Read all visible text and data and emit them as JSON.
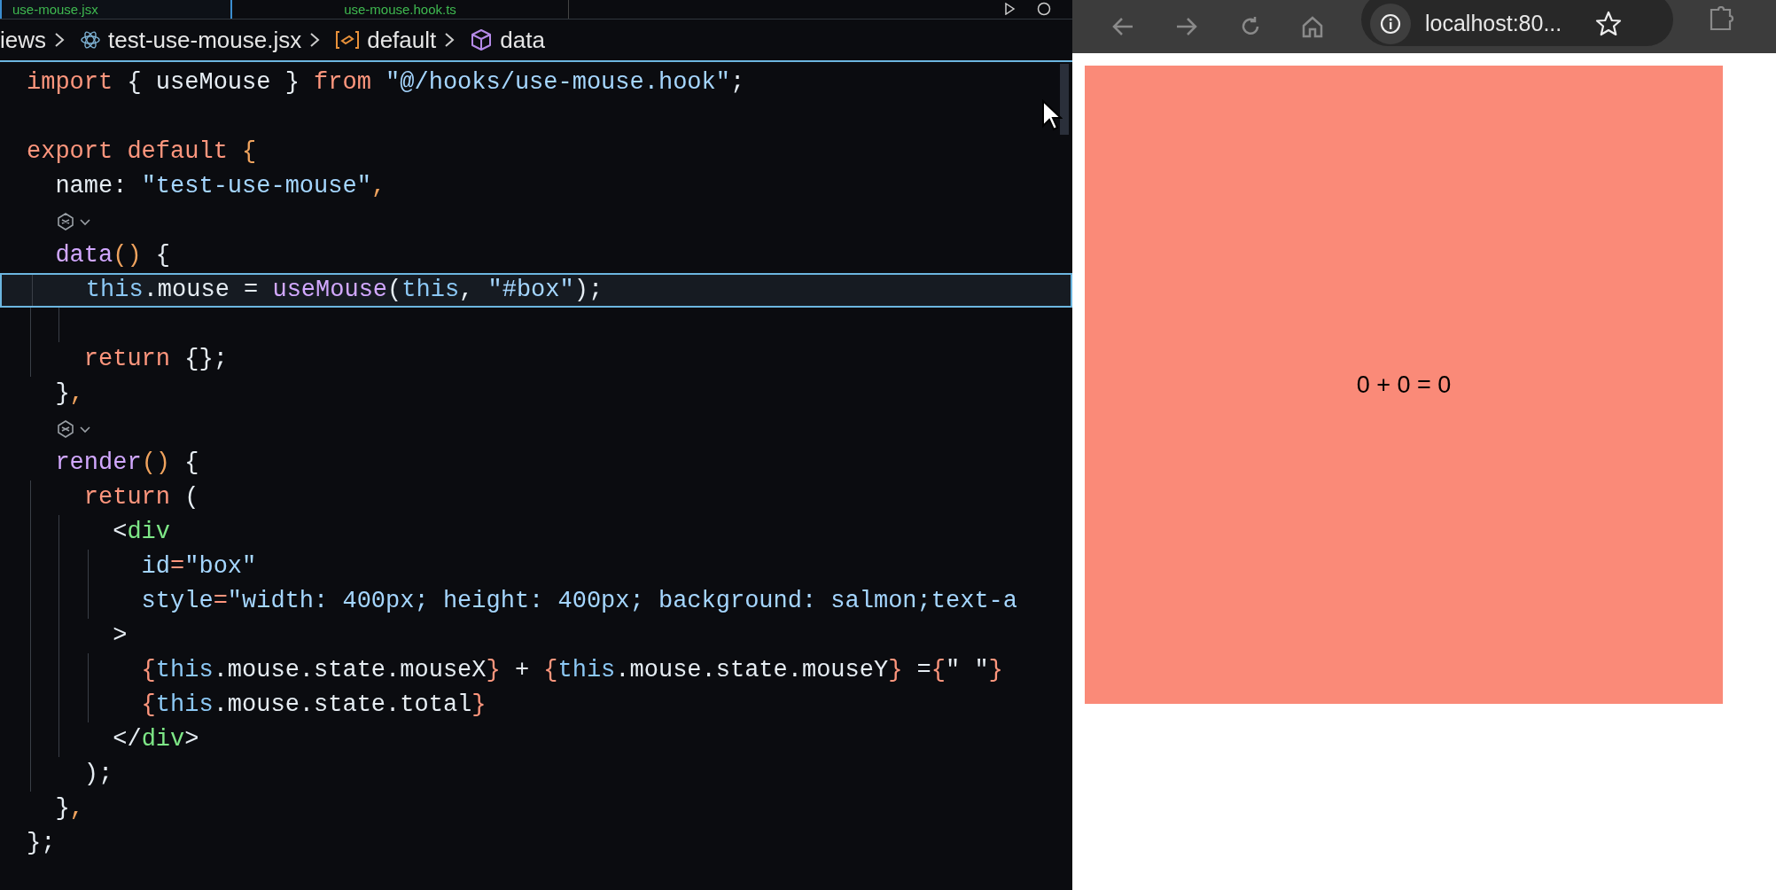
{
  "editor": {
    "tabs": [
      {
        "label": "use-mouse.jsx",
        "selected": true
      },
      {
        "label": "use-mouse.hook.ts",
        "selected": false
      }
    ],
    "breadcrumb": [
      {
        "kind": "folder",
        "label": "iews"
      },
      {
        "kind": "react",
        "label": "test-use-mouse.jsx"
      },
      {
        "kind": "module",
        "label": "default"
      },
      {
        "kind": "method",
        "label": "data"
      }
    ],
    "lines": [
      {
        "kind": "code",
        "tokens": [
          {
            "kind": "kw",
            "text": "import"
          },
          {
            "kind": "plain",
            "text": " { useMouse } "
          },
          {
            "kind": "kw",
            "text": "from"
          },
          {
            "kind": "str",
            "text": " \"@/hooks/use-mouse.hook\""
          },
          {
            "kind": "plain",
            "text": ";"
          }
        ]
      },
      {
        "kind": "blank"
      },
      {
        "kind": "code",
        "tokens": [
          {
            "kind": "kw",
            "text": "export default"
          },
          {
            "kind": "brace",
            "text": " {"
          }
        ]
      },
      {
        "kind": "code",
        "tokens": [
          {
            "kind": "plain",
            "text": "  name: "
          },
          {
            "kind": "str",
            "text": "\"test-use-mouse\""
          },
          {
            "kind": "brace",
            "text": ","
          }
        ]
      },
      {
        "kind": "codelens"
      },
      {
        "kind": "code",
        "tokens": [
          {
            "kind": "fn",
            "text": "  data"
          },
          {
            "kind": "brace",
            "text": "()"
          },
          {
            "kind": "plain",
            "text": " {"
          }
        ]
      },
      {
        "kind": "code",
        "current": true,
        "tokens": [
          {
            "kind": "this",
            "text": "    this"
          },
          {
            "kind": "plain",
            "text": ".mouse = "
          },
          {
            "kind": "fn",
            "text": "useMouse"
          },
          {
            "kind": "plain",
            "text": "("
          },
          {
            "kind": "this",
            "text": "this"
          },
          {
            "kind": "plain",
            "text": ", "
          },
          {
            "kind": "str",
            "text": "\"#box\""
          },
          {
            "kind": "plain",
            "text": ");"
          }
        ]
      },
      {
        "kind": "blank"
      },
      {
        "kind": "code",
        "tokens": [
          {
            "kind": "kw",
            "text": "    return"
          },
          {
            "kind": "plain",
            "text": " {};"
          }
        ]
      },
      {
        "kind": "code",
        "tokens": [
          {
            "kind": "plain",
            "text": "  }"
          },
          {
            "kind": "brace",
            "text": ","
          }
        ]
      },
      {
        "kind": "codelens"
      },
      {
        "kind": "code",
        "tokens": [
          {
            "kind": "fn",
            "text": "  render"
          },
          {
            "kind": "brace",
            "text": "()"
          },
          {
            "kind": "plain",
            "text": " {"
          }
        ]
      },
      {
        "kind": "code",
        "tokens": [
          {
            "kind": "kw",
            "text": "    return"
          },
          {
            "kind": "plain",
            "text": " ("
          }
        ]
      },
      {
        "kind": "code",
        "tokens": [
          {
            "kind": "plain",
            "text": "      <"
          },
          {
            "kind": "tag",
            "text": "div"
          }
        ]
      },
      {
        "kind": "code",
        "tokens": [
          {
            "kind": "attr",
            "text": "        id"
          },
          {
            "kind": "kw",
            "text": "="
          },
          {
            "kind": "str",
            "text": "\"box\""
          }
        ]
      },
      {
        "kind": "code",
        "tokens": [
          {
            "kind": "attr",
            "text": "        style"
          },
          {
            "kind": "kw",
            "text": "="
          },
          {
            "kind": "str",
            "text": "\"width: 400px; height: 400px; background: salmon;text-a"
          }
        ]
      },
      {
        "kind": "code",
        "tokens": [
          {
            "kind": "plain",
            "text": "      >"
          }
        ]
      },
      {
        "kind": "code",
        "tokens": [
          {
            "kind": "kw",
            "text": "        {"
          },
          {
            "kind": "this",
            "text": "this"
          },
          {
            "kind": "plain",
            "text": ".mouse.state.mouseX"
          },
          {
            "kind": "kw",
            "text": "}"
          },
          {
            "kind": "plain",
            "text": " + "
          },
          {
            "kind": "kw",
            "text": "{"
          },
          {
            "kind": "this",
            "text": "this"
          },
          {
            "kind": "plain",
            "text": ".mouse.state.mouseY"
          },
          {
            "kind": "kw",
            "text": "}"
          },
          {
            "kind": "plain",
            "text": " ="
          },
          {
            "kind": "kw",
            "text": "{"
          },
          {
            "kind": "plain",
            "text": "\" \""
          },
          {
            "kind": "kw",
            "text": "}"
          }
        ]
      },
      {
        "kind": "code",
        "tokens": [
          {
            "kind": "kw",
            "text": "        {"
          },
          {
            "kind": "this",
            "text": "this"
          },
          {
            "kind": "plain",
            "text": ".mouse.state.total"
          },
          {
            "kind": "kw",
            "text": "}"
          }
        ]
      },
      {
        "kind": "code",
        "tokens": [
          {
            "kind": "plain",
            "text": "      </"
          },
          {
            "kind": "tag",
            "text": "div"
          },
          {
            "kind": "plain",
            "text": ">"
          }
        ]
      },
      {
        "kind": "code",
        "tokens": [
          {
            "kind": "plain",
            "text": "    );"
          }
        ]
      },
      {
        "kind": "code",
        "tokens": [
          {
            "kind": "plain",
            "text": "  }"
          },
          {
            "kind": "brace",
            "text": ","
          }
        ]
      },
      {
        "kind": "code",
        "tokens": [
          {
            "kind": "plain",
            "text": "};"
          }
        ]
      }
    ]
  },
  "browser": {
    "address": "localhost:80...",
    "box_text": "0 + 0 = 0"
  }
}
